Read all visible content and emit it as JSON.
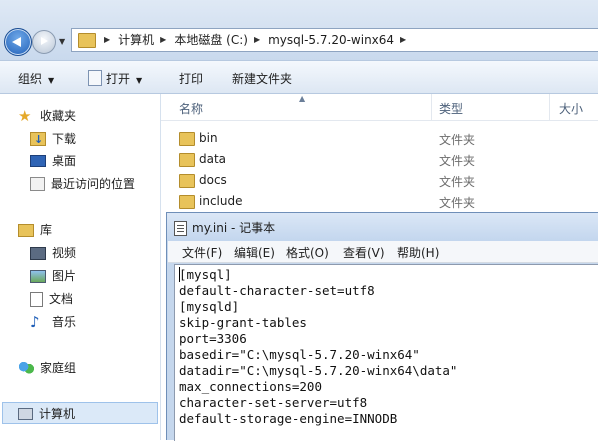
{
  "address": {
    "crumbs": [
      "计算机",
      "本地磁盘 (C:)",
      "mysql-5.7.20-winx64"
    ]
  },
  "toolbar": {
    "organize": "组织",
    "open": "打开",
    "print": "打印",
    "new_folder": "新建文件夹"
  },
  "nav": {
    "favorites": "收藏夹",
    "downloads": "下载",
    "desktop": "桌面",
    "recent": "最近访问的位置",
    "libraries": "库",
    "videos": "视频",
    "pictures": "图片",
    "documents": "文档",
    "music": "音乐",
    "homegroup": "家庭组",
    "computer": "计算机"
  },
  "files": {
    "columns": {
      "name": "名称",
      "type": "类型",
      "size": "大小"
    },
    "rows": [
      {
        "name": "bin",
        "type": "文件夹"
      },
      {
        "name": "data",
        "type": "文件夹"
      },
      {
        "name": "docs",
        "type": "文件夹"
      },
      {
        "name": "include",
        "type": "文件夹"
      }
    ]
  },
  "notepad": {
    "title": "my.ini - 记事本",
    "menu": [
      "文件(F)",
      "编辑(E)",
      "格式(O)",
      "查看(V)",
      "帮助(H)"
    ],
    "lines": [
      "[mysql]",
      "default-character-set=utf8",
      "[mysqld]",
      "skip-grant-tables",
      "port=3306",
      "basedir=\"C:\\mysql-5.7.20-winx64\"",
      "datadir=\"C:\\mysql-5.7.20-winx64\\data\"",
      "max_connections=200",
      "character-set-server=utf8",
      "default-storage-engine=INNODB"
    ]
  }
}
